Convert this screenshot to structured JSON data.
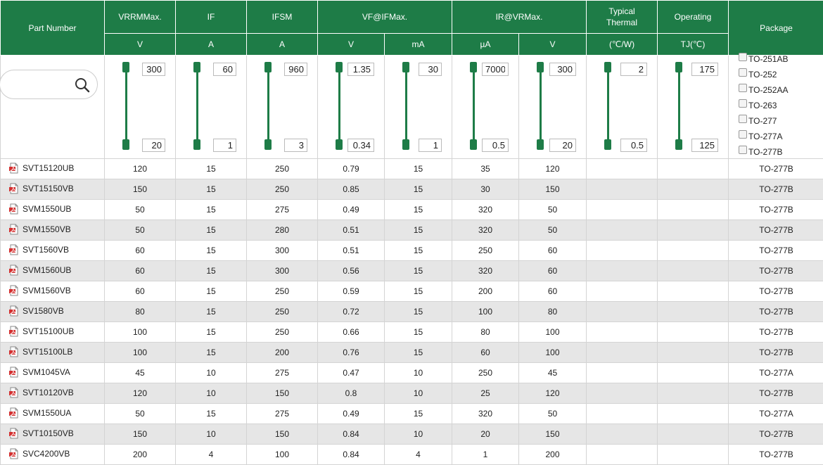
{
  "headers": {
    "part_number": "Part Number",
    "vrrm": "VRRMMax.",
    "if": "IF",
    "ifsm": "IFSM",
    "vf": "VF@IFMax.",
    "ir": "IR@VRMax.",
    "thermal_line1": "Typical",
    "thermal_line2": "Thermal",
    "operating": "Operating",
    "package": "Package"
  },
  "units": [
    "V",
    "A",
    "A",
    "V",
    "mA",
    "µA",
    "V",
    "(℃/W)",
    "TJ(℃)"
  ],
  "filters": {
    "search": {
      "value": "",
      "placeholder": ""
    },
    "ranges": [
      {
        "column": "VRRM",
        "max": "300",
        "min": "20"
      },
      {
        "column": "IF",
        "max": "60",
        "min": "1"
      },
      {
        "column": "IFSM",
        "max": "960",
        "min": "3"
      },
      {
        "column": "VF",
        "max": "1.35",
        "min": "0.34"
      },
      {
        "column": "IF_test",
        "max": "30",
        "min": "1"
      },
      {
        "column": "IR",
        "max": "7000",
        "min": "0.5"
      },
      {
        "column": "VR",
        "max": "300",
        "min": "20"
      },
      {
        "column": "Thermal",
        "max": "2",
        "min": "0.5"
      },
      {
        "column": "TJ",
        "max": "175",
        "min": "125"
      }
    ],
    "packages": [
      "TO-251AB",
      "TO-252",
      "TO-252AA",
      "TO-263",
      "TO-277",
      "TO-277A",
      "TO-277B"
    ]
  },
  "icons": {
    "search": "search-icon",
    "pdf": "pdf-icon",
    "checkbox": "checkbox-icon"
  },
  "colors": {
    "header_bg": "#1e7c47",
    "row_alt": "#e6e6e6",
    "pdf_red": "#d32f2f"
  },
  "rows": [
    {
      "part": "SVT15120UB",
      "vrrm": "120",
      "if": "15",
      "ifsm": "250",
      "vf": "0.79",
      "ift": "15",
      "ir": "35",
      "vr": "120",
      "thermal": "",
      "tj": "",
      "pkg": "TO-277B"
    },
    {
      "part": "SVT15150VB",
      "vrrm": "150",
      "if": "15",
      "ifsm": "250",
      "vf": "0.85",
      "ift": "15",
      "ir": "30",
      "vr": "150",
      "thermal": "",
      "tj": "",
      "pkg": "TO-277B"
    },
    {
      "part": "SVM1550UB",
      "vrrm": "50",
      "if": "15",
      "ifsm": "275",
      "vf": "0.49",
      "ift": "15",
      "ir": "320",
      "vr": "50",
      "thermal": "",
      "tj": "",
      "pkg": "TO-277B"
    },
    {
      "part": "SVM1550VB",
      "vrrm": "50",
      "if": "15",
      "ifsm": "280",
      "vf": "0.51",
      "ift": "15",
      "ir": "320",
      "vr": "50",
      "thermal": "",
      "tj": "",
      "pkg": "TO-277B"
    },
    {
      "part": "SVT1560VB",
      "vrrm": "60",
      "if": "15",
      "ifsm": "300",
      "vf": "0.51",
      "ift": "15",
      "ir": "250",
      "vr": "60",
      "thermal": "",
      "tj": "",
      "pkg": "TO-277B"
    },
    {
      "part": "SVM1560UB",
      "vrrm": "60",
      "if": "15",
      "ifsm": "300",
      "vf": "0.56",
      "ift": "15",
      "ir": "320",
      "vr": "60",
      "thermal": "",
      "tj": "",
      "pkg": "TO-277B"
    },
    {
      "part": "SVM1560VB",
      "vrrm": "60",
      "if": "15",
      "ifsm": "250",
      "vf": "0.59",
      "ift": "15",
      "ir": "200",
      "vr": "60",
      "thermal": "",
      "tj": "",
      "pkg": "TO-277B"
    },
    {
      "part": "SV1580VB",
      "vrrm": "80",
      "if": "15",
      "ifsm": "250",
      "vf": "0.72",
      "ift": "15",
      "ir": "100",
      "vr": "80",
      "thermal": "",
      "tj": "",
      "pkg": "TO-277B"
    },
    {
      "part": "SVT15100UB",
      "vrrm": "100",
      "if": "15",
      "ifsm": "250",
      "vf": "0.66",
      "ift": "15",
      "ir": "80",
      "vr": "100",
      "thermal": "",
      "tj": "",
      "pkg": "TO-277B"
    },
    {
      "part": "SVT15100LB",
      "vrrm": "100",
      "if": "15",
      "ifsm": "200",
      "vf": "0.76",
      "ift": "15",
      "ir": "60",
      "vr": "100",
      "thermal": "",
      "tj": "",
      "pkg": "TO-277B"
    },
    {
      "part": "SVM1045VA",
      "vrrm": "45",
      "if": "10",
      "ifsm": "275",
      "vf": "0.47",
      "ift": "10",
      "ir": "250",
      "vr": "45",
      "thermal": "",
      "tj": "",
      "pkg": "TO-277A"
    },
    {
      "part": "SVT10120VB",
      "vrrm": "120",
      "if": "10",
      "ifsm": "150",
      "vf": "0.8",
      "ift": "10",
      "ir": "25",
      "vr": "120",
      "thermal": "",
      "tj": "",
      "pkg": "TO-277B"
    },
    {
      "part": "SVM1550UA",
      "vrrm": "50",
      "if": "15",
      "ifsm": "275",
      "vf": "0.49",
      "ift": "15",
      "ir": "320",
      "vr": "50",
      "thermal": "",
      "tj": "",
      "pkg": "TO-277A"
    },
    {
      "part": "SVT10150VB",
      "vrrm": "150",
      "if": "10",
      "ifsm": "150",
      "vf": "0.84",
      "ift": "10",
      "ir": "20",
      "vr": "150",
      "thermal": "",
      "tj": "",
      "pkg": "TO-277B"
    },
    {
      "part": "SVC4200VB",
      "vrrm": "200",
      "if": "4",
      "ifsm": "100",
      "vf": "0.84",
      "ift": "4",
      "ir": "1",
      "vr": "200",
      "thermal": "",
      "tj": "",
      "pkg": "TO-277B"
    }
  ]
}
